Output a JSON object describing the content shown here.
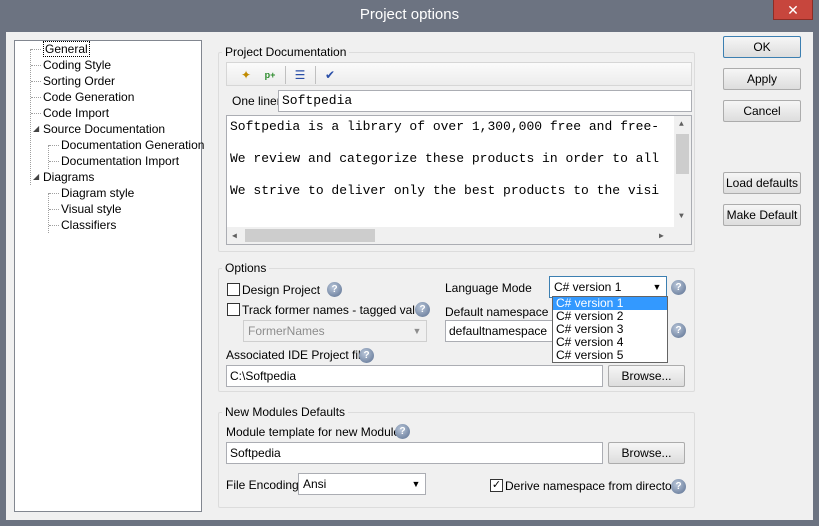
{
  "window": {
    "title": "Project options",
    "close_glyph": "✕"
  },
  "tree": {
    "items": [
      {
        "label": "General",
        "level": 0,
        "selected": true
      },
      {
        "label": "Coding Style",
        "level": 0
      },
      {
        "label": "Sorting Order",
        "level": 0
      },
      {
        "label": "Code Generation",
        "level": 0
      },
      {
        "label": "Code Import",
        "level": 0
      },
      {
        "label": "Source Documentation",
        "level": 0,
        "expanded": true
      },
      {
        "label": "Documentation Generation",
        "level": 1
      },
      {
        "label": "Documentation Import",
        "level": 1
      },
      {
        "label": "Diagrams",
        "level": 0,
        "expanded": true
      },
      {
        "label": "Diagram style",
        "level": 1
      },
      {
        "label": "Visual style",
        "level": 1
      },
      {
        "label": "Classifiers",
        "level": 1
      }
    ]
  },
  "project_doc": {
    "title": "Project Documentation",
    "toolbar_icons": [
      "magic-wand-icon",
      "add-paragraph-icon",
      "list-format-icon",
      "spell-check-icon"
    ],
    "one_liner_label": "One liner",
    "one_liner_value": "Softpedia",
    "memo_lines": [
      "Softpedia is a library of over 1,300,000 free and free-",
      "We review and categorize these products in order to all",
      "We strive to deliver only the best products to the visi"
    ]
  },
  "options": {
    "title": "Options",
    "design_project_label": "Design Project",
    "track_former_label": "Track former names - tagged value",
    "former_names_value": "FormerNames",
    "language_mode_label": "Language Mode",
    "language_mode_value": "C# version 1",
    "language_mode_options": [
      "C# version 1",
      "C# version 2",
      "C# version 3",
      "C# version 4",
      "C# version 5"
    ],
    "default_namespace_label": "Default namespace",
    "default_namespace_value": "defaultnamespace",
    "ide_file_label": "Associated IDE Project file",
    "ide_file_value": "C:\\Softpedia",
    "browse_label": "Browse..."
  },
  "new_modules": {
    "title": "New Modules Defaults",
    "template_label": "Module template for new Modules",
    "template_value": "Softpedia",
    "browse_label": "Browse...",
    "file_encoding_label": "File Encoding",
    "file_encoding_value": "Ansi",
    "derive_namespace_label": "Derive namespace from directory",
    "derive_namespace_checked": true
  },
  "buttons": {
    "ok": "OK",
    "apply": "Apply",
    "cancel": "Cancel",
    "load_defaults": "Load defaults",
    "make_default": "Make Default"
  },
  "colors": {
    "selection": "#3399ff",
    "close": "#c7463d"
  }
}
